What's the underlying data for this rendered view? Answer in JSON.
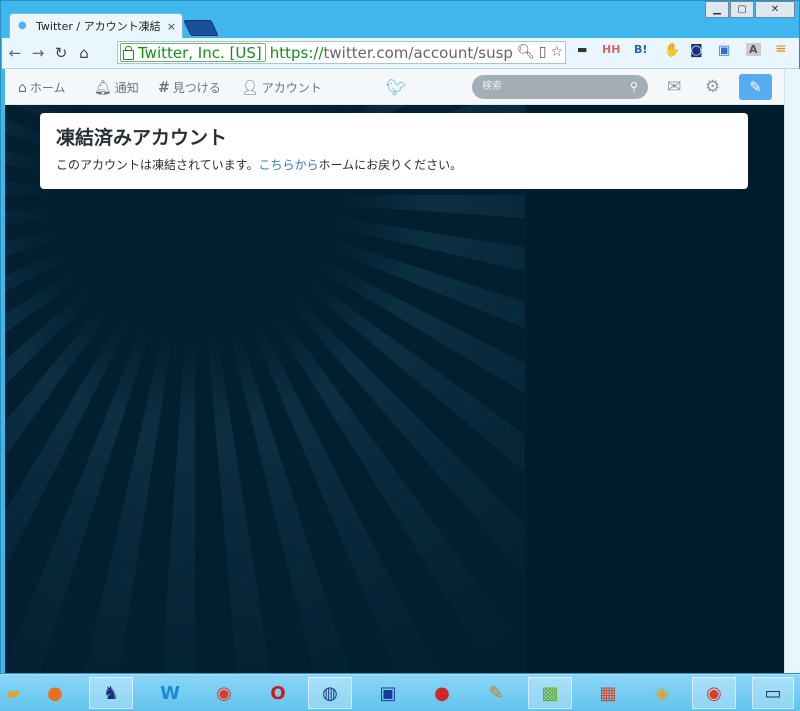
{
  "browser": {
    "tab_title": "Twitter / アカウント凍結",
    "tab_close": "×",
    "url": {
      "ev_org": "Twitter, Inc. [US]",
      "scheme": "https://",
      "rest": "twitter.com/account/suspe"
    },
    "window_buttons": {
      "minimize": "▁",
      "maximize": "▢",
      "close": "✕"
    },
    "extensions": [
      "HH",
      "B!",
      "A"
    ]
  },
  "twitter": {
    "nav": {
      "home": "ホーム",
      "notifications": "通知",
      "discover": "見つける",
      "account": "アカウント"
    },
    "search_placeholder": "検索"
  },
  "card": {
    "title": "凍結済みアカウント",
    "message_before": "このアカウントは凍結されています。",
    "link_text": "こちらから",
    "message_after": "ホームにお戻りください。"
  },
  "colors": {
    "twitter_blue": "#55acee",
    "page_bg": "#021f30",
    "link": "#2b7bb9"
  }
}
